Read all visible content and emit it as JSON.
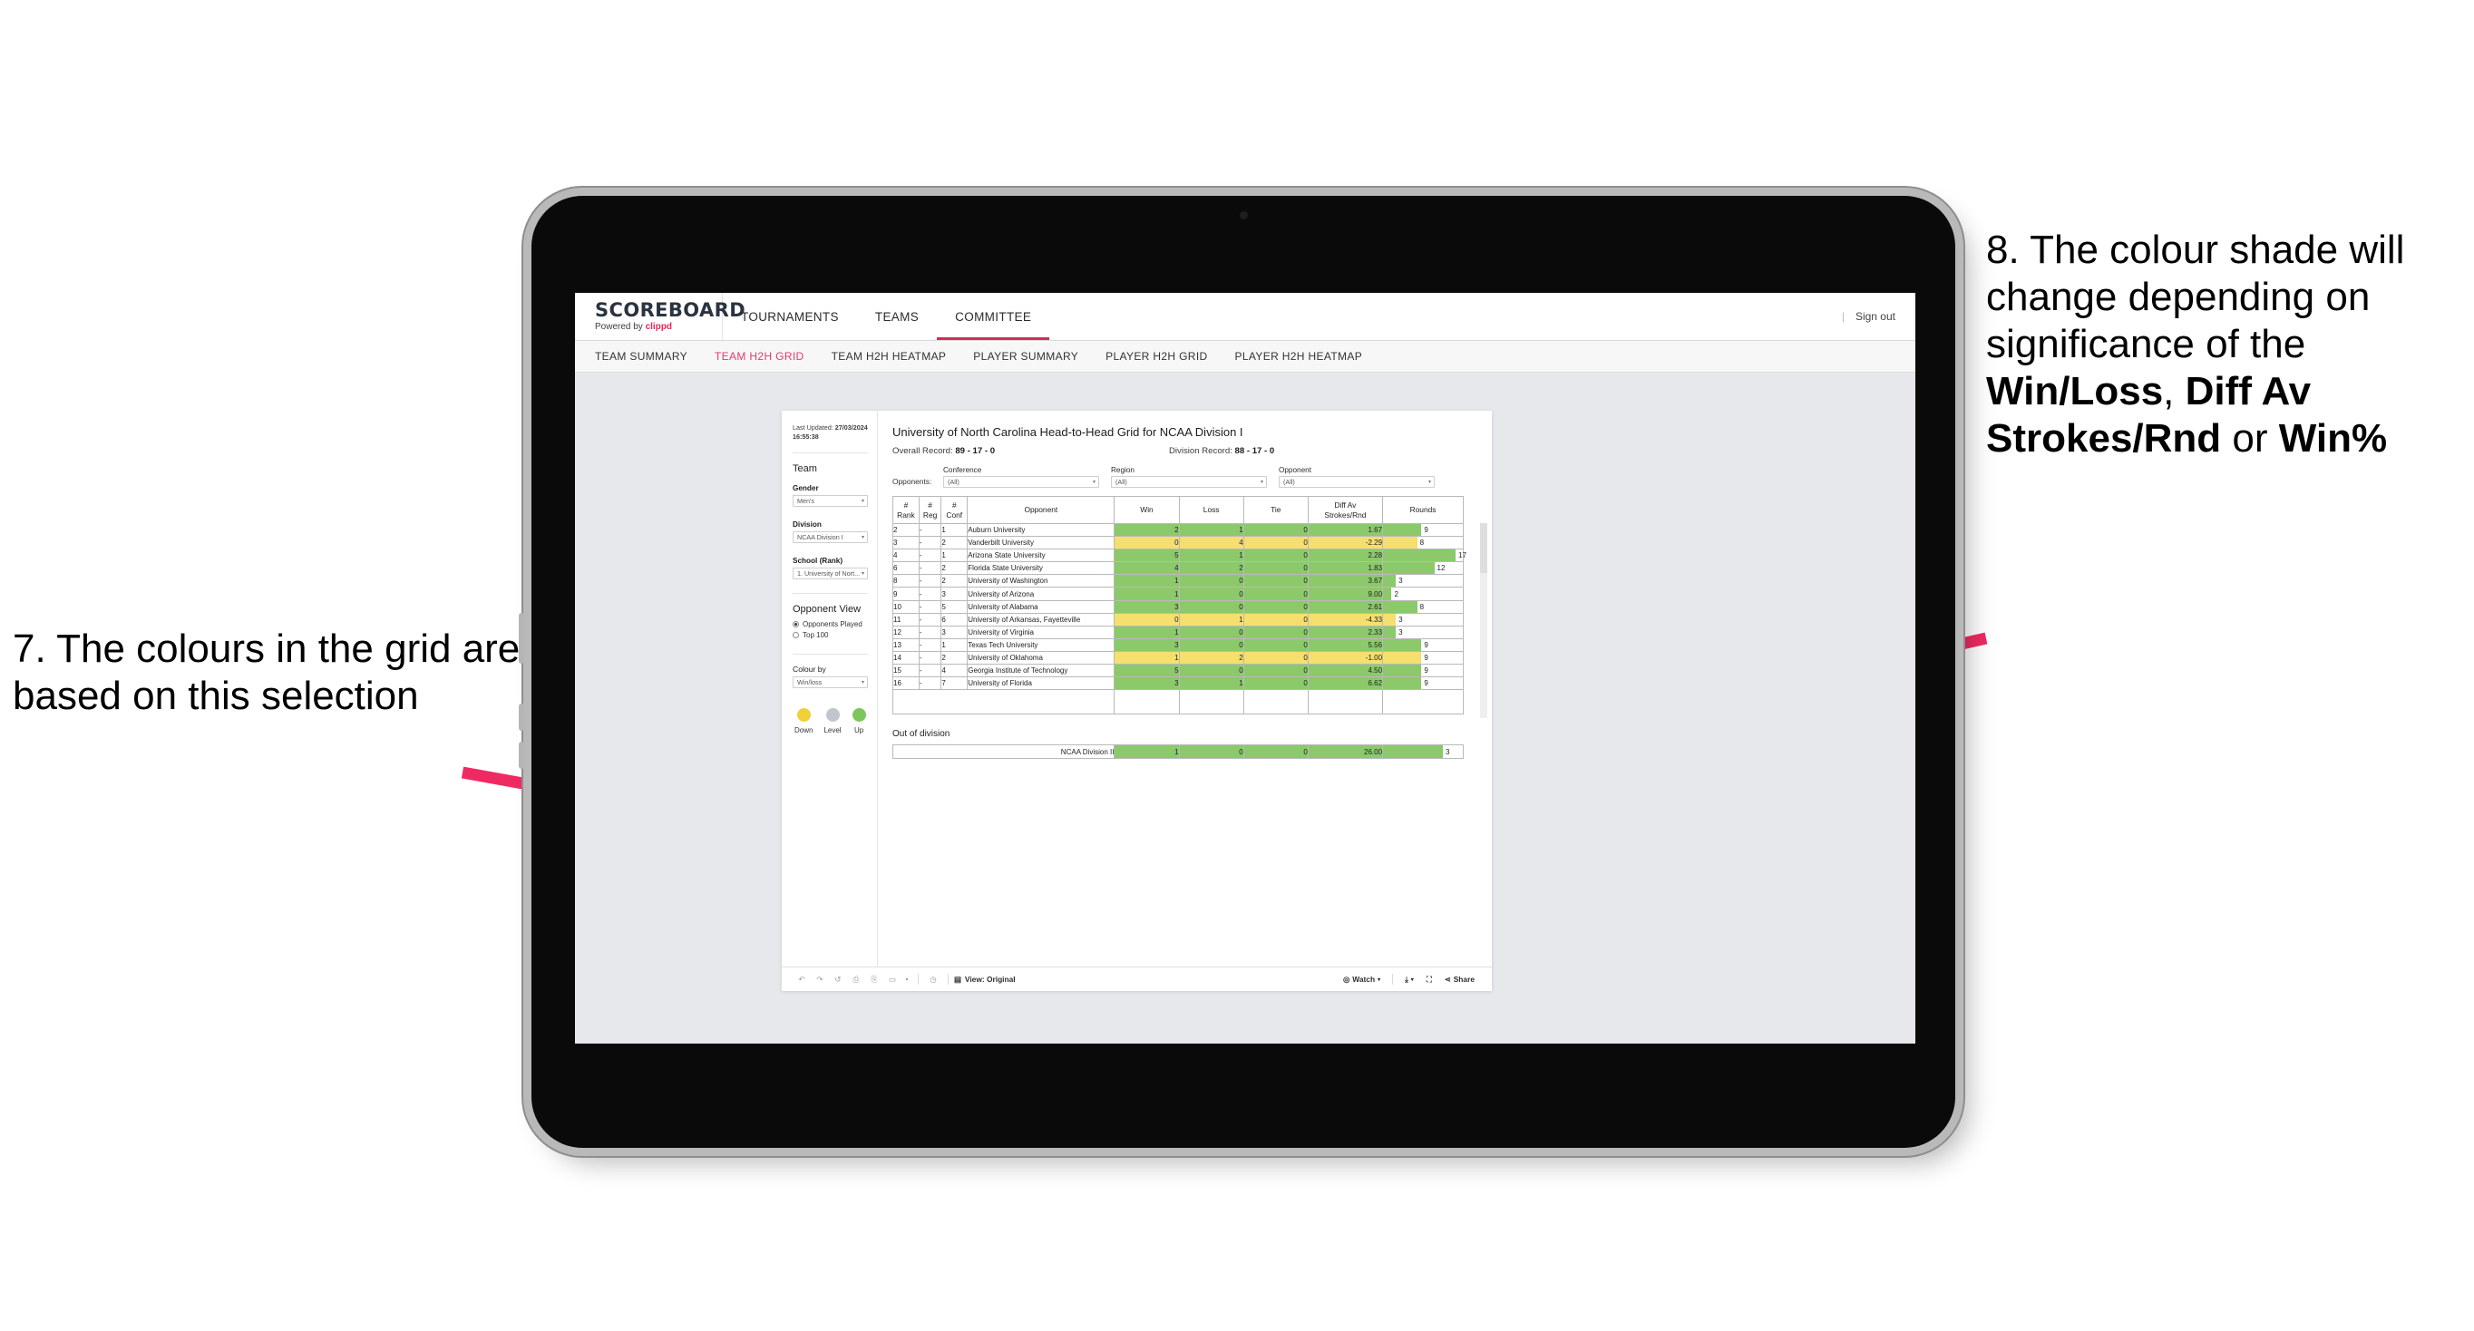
{
  "callouts": {
    "left": "7. The colours in the grid are based on this selection",
    "right_pre": "8. The colour shade will change depending on significance of the ",
    "right_b1": "Win/Loss",
    "right_mid1": ", ",
    "right_b2": "Diff Av Strokes/Rnd",
    "right_mid2": " or ",
    "right_b3": "Win%"
  },
  "header": {
    "logo_main": "SCOREBOARD",
    "logo_sub_prefix": "Powered by ",
    "logo_sub_brand": "clippd",
    "nav": [
      {
        "label": "TOURNAMENTS",
        "active": false
      },
      {
        "label": "TEAMS",
        "active": false
      },
      {
        "label": "COMMITTEE",
        "active": true
      }
    ],
    "separator": "|",
    "sign_out": "Sign out"
  },
  "sub_tabs": [
    {
      "label": "TEAM SUMMARY",
      "active": false
    },
    {
      "label": "TEAM H2H GRID",
      "active": true
    },
    {
      "label": "TEAM H2H HEATMAP",
      "active": false
    },
    {
      "label": "PLAYER SUMMARY",
      "active": false
    },
    {
      "label": "PLAYER H2H GRID",
      "active": false
    },
    {
      "label": "PLAYER H2H HEATMAP",
      "active": false
    }
  ],
  "sidebar": {
    "updated_label": "Last Updated: ",
    "updated_value": "27/03/2024 16:55:38",
    "team_heading": "Team",
    "gender_label": "Gender",
    "gender_value": "Men's",
    "division_label": "Division",
    "division_value": "NCAA Division I",
    "school_label": "School (Rank)",
    "school_value": "1. University of Nort...",
    "opponent_view_heading": "Opponent View",
    "radio_options": [
      {
        "label": "Opponents Played",
        "selected": true
      },
      {
        "label": "Top 100",
        "selected": false
      }
    ],
    "colour_by_label": "Colour by",
    "colour_by_value": "Win/loss",
    "legend": [
      {
        "label": "Down",
        "color": "#F2D03C"
      },
      {
        "label": "Level",
        "color": "#C2C6CC"
      },
      {
        "label": "Up",
        "color": "#7DC75A"
      }
    ]
  },
  "main": {
    "title": "University of North Carolina Head-to-Head Grid for NCAA Division I",
    "overall_record_label": "Overall Record: ",
    "overall_record_value": "89 - 17 - 0",
    "division_record_label": "Division Record: ",
    "division_record_value": "88 - 17 - 0",
    "opponents_label": "Opponents:",
    "filters": [
      {
        "label": "Conference",
        "value": "(All)"
      },
      {
        "label": "Region",
        "value": "(All)"
      },
      {
        "label": "Opponent",
        "value": "(All)"
      }
    ],
    "out_of_division_title": "Out of division",
    "out_of_division_row": {
      "name": "NCAA Division II",
      "win": "1",
      "loss": "0",
      "tie": "0",
      "diff": "26.00",
      "rounds": "3",
      "color": "#8BC96B"
    }
  },
  "chart_data": {
    "type": "table",
    "title": "University of North Carolina Head-to-Head Grid for NCAA Division I",
    "columns": [
      "# Rank",
      "# Reg",
      "# Conf",
      "Opponent",
      "Win",
      "Loss",
      "Tie",
      "Diff Av Strokes/Rnd",
      "Rounds"
    ],
    "column_headers_multiline": [
      [
        "#",
        "Rank"
      ],
      [
        "#",
        "Reg"
      ],
      [
        "#",
        "Conf"
      ],
      [
        "Opponent"
      ],
      [
        "Win"
      ],
      [
        "Loss"
      ],
      [
        "Tie"
      ],
      [
        "Diff Av",
        "Strokes/Rnd"
      ],
      [
        "Rounds"
      ]
    ],
    "colour_by": "Win/loss",
    "colors": {
      "up": "#8BC96B",
      "down": "#F5DF6E",
      "level": "#C2C6CC"
    },
    "rounds_max": 17,
    "rows": [
      {
        "rank": "2",
        "reg": "-",
        "conf": "1",
        "opponent": "Auburn University",
        "win": "2",
        "loss": "1",
        "tie": "0",
        "diff": "1.67",
        "rounds": "9",
        "color": "#8BC96B"
      },
      {
        "rank": "3",
        "reg": "-",
        "conf": "2",
        "opponent": "Vanderbilt University",
        "win": "0",
        "loss": "4",
        "tie": "0",
        "diff": "-2.29",
        "rounds": "8",
        "color": "#F5DF6E"
      },
      {
        "rank": "4",
        "reg": "-",
        "conf": "1",
        "opponent": "Arizona State University",
        "win": "5",
        "loss": "1",
        "tie": "0",
        "diff": "2.28",
        "rounds": "17",
        "color": "#8BC96B"
      },
      {
        "rank": "6",
        "reg": "-",
        "conf": "2",
        "opponent": "Florida State University",
        "win": "4",
        "loss": "2",
        "tie": "0",
        "diff": "1.83",
        "rounds": "12",
        "color": "#8BC96B"
      },
      {
        "rank": "8",
        "reg": "-",
        "conf": "2",
        "opponent": "University of Washington",
        "win": "1",
        "loss": "0",
        "tie": "0",
        "diff": "3.67",
        "rounds": "3",
        "color": "#8BC96B"
      },
      {
        "rank": "9",
        "reg": "-",
        "conf": "3",
        "opponent": "University of Arizona",
        "win": "1",
        "loss": "0",
        "tie": "0",
        "diff": "9.00",
        "rounds": "2",
        "color": "#8BC96B"
      },
      {
        "rank": "10",
        "reg": "-",
        "conf": "5",
        "opponent": "University of Alabama",
        "win": "3",
        "loss": "0",
        "tie": "0",
        "diff": "2.61",
        "rounds": "8",
        "color": "#8BC96B"
      },
      {
        "rank": "11",
        "reg": "-",
        "conf": "6",
        "opponent": "University of Arkansas, Fayetteville",
        "win": "0",
        "loss": "1",
        "tie": "0",
        "diff": "-4.33",
        "rounds": "3",
        "color": "#F5DF6E"
      },
      {
        "rank": "12",
        "reg": "-",
        "conf": "3",
        "opponent": "University of Virginia",
        "win": "1",
        "loss": "0",
        "tie": "0",
        "diff": "2.33",
        "rounds": "3",
        "color": "#8BC96B"
      },
      {
        "rank": "13",
        "reg": "-",
        "conf": "1",
        "opponent": "Texas Tech University",
        "win": "3",
        "loss": "0",
        "tie": "0",
        "diff": "5.56",
        "rounds": "9",
        "color": "#8BC96B"
      },
      {
        "rank": "14",
        "reg": "-",
        "conf": "2",
        "opponent": "University of Oklahoma",
        "win": "1",
        "loss": "2",
        "tie": "0",
        "diff": "-1.00",
        "rounds": "9",
        "color": "#F5DF6E"
      },
      {
        "rank": "15",
        "reg": "-",
        "conf": "4",
        "opponent": "Georgia Institute of Technology",
        "win": "5",
        "loss": "0",
        "tie": "0",
        "diff": "4.50",
        "rounds": "9",
        "color": "#8BC96B"
      },
      {
        "rank": "16",
        "reg": "-",
        "conf": "7",
        "opponent": "University of Florida",
        "win": "3",
        "loss": "1",
        "tie": "0",
        "diff": "6.62",
        "rounds": "9",
        "color": "#8BC96B"
      }
    ]
  },
  "toolbar": {
    "view_label": "View: Original",
    "watch_label": "Watch",
    "share_label": "Share"
  }
}
